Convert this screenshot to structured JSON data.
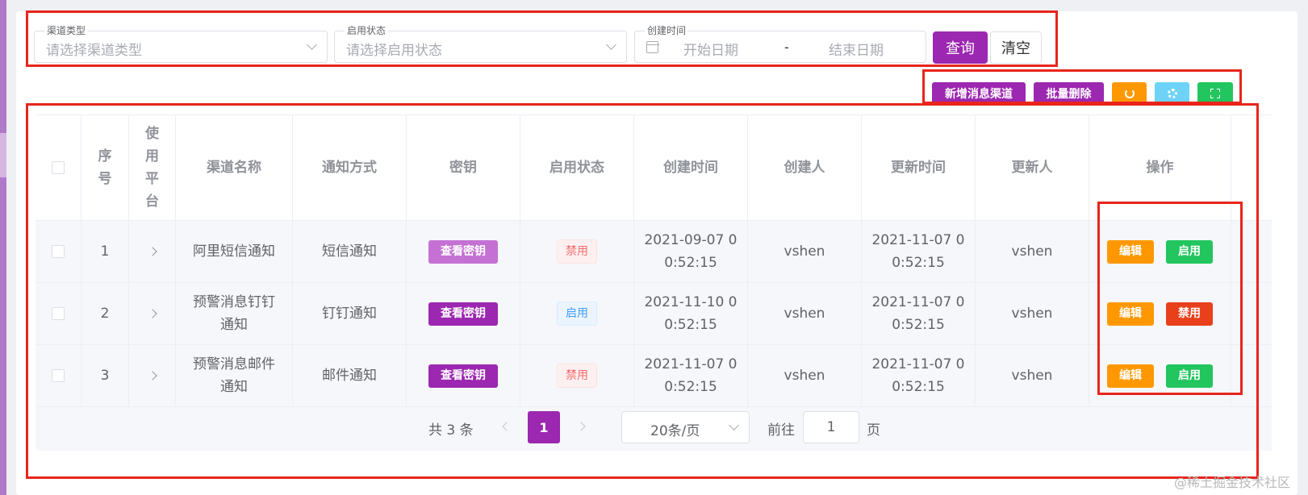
{
  "filters": {
    "channel_type": {
      "label": "渠道类型",
      "placeholder": "请选择渠道类型"
    },
    "enable_status": {
      "label": "启用状态",
      "placeholder": "请选择启用状态"
    },
    "created_time": {
      "label": "创建时间",
      "start_placeholder": "开始日期",
      "separator": "-",
      "end_placeholder": "结束日期"
    },
    "query_label": "查询",
    "clear_label": "清空"
  },
  "toolbar": {
    "add_label": "新增消息渠道",
    "batch_delete_label": "批量删除",
    "icons": [
      "refresh-icon",
      "settings-icon",
      "fullscreen-icon"
    ],
    "colors": {
      "purple": "#9c27b0",
      "orange": "#ff9800",
      "cyan": "#6ed3f7",
      "green": "#22c55e",
      "red": "#e8251b"
    }
  },
  "table": {
    "headers": [
      "序号",
      "使用平台",
      "渠道名称",
      "通知方式",
      "密钥",
      "启用状态",
      "创建时间",
      "创建人",
      "更新时间",
      "更新人",
      "操作"
    ],
    "header_platform_chars": [
      "使",
      "用",
      "平",
      "台"
    ],
    "header_index_chars": [
      "序",
      "号"
    ],
    "rows": [
      {
        "index": "1",
        "name_l1": "阿里短信通知",
        "name_l2": "",
        "method": "短信通知",
        "key_label": "查看密钥",
        "key_color": "#c471d3",
        "status": "禁用",
        "created_l1": "2021-09-07 0",
        "created_l2": "0:52:15",
        "creator": "vshen",
        "updated_l1": "2021-11-07 0",
        "updated_l2": "0:52:15",
        "updater": "vshen",
        "edit_label": "编辑",
        "toggle_label": "启用",
        "toggle_color": "#22c55e"
      },
      {
        "index": "2",
        "name_l1": "预警消息钉钉",
        "name_l2": "通知",
        "method": "钉钉通知",
        "key_label": "查看密钥",
        "key_color": "#9c27b0",
        "status": "启用",
        "created_l1": "2021-11-10 0",
        "created_l2": "0:52:15",
        "creator": "vshen",
        "updated_l1": "2021-11-07 0",
        "updated_l2": "0:52:15",
        "updater": "vshen",
        "edit_label": "编辑",
        "toggle_label": "禁用",
        "toggle_color": "#e8401b"
      },
      {
        "index": "3",
        "name_l1": "预警消息邮件",
        "name_l2": "通知",
        "method": "邮件通知",
        "key_label": "查看密钥",
        "key_color": "#9c27b0",
        "status": "禁用",
        "created_l1": "2021-11-07 0",
        "created_l2": "0:52:15",
        "creator": "vshen",
        "updated_l1": "2021-11-07 0",
        "updated_l2": "0:52:15",
        "updater": "vshen",
        "edit_label": "编辑",
        "toggle_label": "启用",
        "toggle_color": "#22c55e"
      }
    ]
  },
  "pagination": {
    "total": "共 3 条",
    "current": "1",
    "page_size": "20条/页",
    "goto_label": "前往",
    "goto_value": "1",
    "page_suffix": "页"
  },
  "watermark": "@稀土掘金技术社区"
}
